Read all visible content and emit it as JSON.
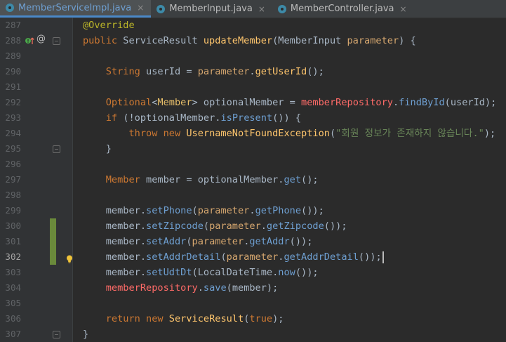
{
  "tabs": [
    {
      "label": "MemberServiceImpl.java",
      "active": true
    },
    {
      "label": "MemberInput.java",
      "active": false
    },
    {
      "label": "MemberController.java",
      "active": false
    }
  ],
  "tab_close_glyph": "×",
  "gutter_glyphs": {
    "at": "@"
  },
  "lines": [
    {
      "n": "287",
      "code": [
        [
          "ann",
          "@Override"
        ]
      ]
    },
    {
      "n": "288",
      "code": [
        [
          "kw",
          "public "
        ],
        [
          "var",
          "ServiceResult "
        ],
        [
          "fn",
          "updateMember"
        ],
        [
          "var",
          "("
        ],
        [
          "var",
          "MemberInput "
        ],
        [
          "param",
          "parameter"
        ],
        [
          "var",
          ") {"
        ]
      ]
    },
    {
      "n": "289",
      "code": []
    },
    {
      "n": "290",
      "code": [
        [
          "var",
          "    "
        ],
        [
          "clsref",
          "String "
        ],
        [
          "var",
          "userId = "
        ],
        [
          "param",
          "parameter"
        ],
        [
          "var",
          "."
        ],
        [
          "fn",
          "getUserId"
        ],
        [
          "var",
          "();"
        ]
      ]
    },
    {
      "n": "291",
      "code": []
    },
    {
      "n": "292",
      "code": [
        [
          "var",
          "    "
        ],
        [
          "clsref",
          "Optional"
        ],
        [
          "var",
          "<"
        ],
        [
          "generic",
          "Member"
        ],
        [
          "var",
          "> optionalMember = "
        ],
        [
          "field-red",
          "memberRepository"
        ],
        [
          "var",
          "."
        ],
        [
          "mtd",
          "findById"
        ],
        [
          "var",
          "(userId);"
        ]
      ]
    },
    {
      "n": "293",
      "code": [
        [
          "var",
          "    "
        ],
        [
          "kw",
          "if "
        ],
        [
          "var",
          "(!optionalMember."
        ],
        [
          "mtd",
          "isPresent"
        ],
        [
          "var",
          "()) {"
        ]
      ]
    },
    {
      "n": "294",
      "code": [
        [
          "var",
          "        "
        ],
        [
          "kw",
          "throw new "
        ],
        [
          "fn",
          "UsernameNotFoundException"
        ],
        [
          "var",
          "("
        ],
        [
          "str",
          "\"회원 정보가 존재하지 않습니다.\""
        ],
        [
          "var",
          ");"
        ]
      ]
    },
    {
      "n": "295",
      "code": [
        [
          "var",
          "    }"
        ]
      ]
    },
    {
      "n": "296",
      "code": []
    },
    {
      "n": "297",
      "code": [
        [
          "var",
          "    "
        ],
        [
          "clsref",
          "Member "
        ],
        [
          "var",
          "member = optionalMember."
        ],
        [
          "mtd",
          "get"
        ],
        [
          "var",
          "();"
        ]
      ]
    },
    {
      "n": "298",
      "code": []
    },
    {
      "n": "299",
      "code": [
        [
          "var",
          "    member."
        ],
        [
          "mtd",
          "setPhone"
        ],
        [
          "var",
          "("
        ],
        [
          "param",
          "parameter"
        ],
        [
          "var",
          "."
        ],
        [
          "mtd",
          "getPhone"
        ],
        [
          "var",
          "());"
        ]
      ]
    },
    {
      "n": "300",
      "code": [
        [
          "var",
          "    member."
        ],
        [
          "mtd",
          "setZipcode"
        ],
        [
          "var",
          "("
        ],
        [
          "param",
          "parameter"
        ],
        [
          "var",
          "."
        ],
        [
          "mtd",
          "getZipcode"
        ],
        [
          "var",
          "());"
        ]
      ]
    },
    {
      "n": "301",
      "code": [
        [
          "var",
          "    member."
        ],
        [
          "mtd",
          "setAddr"
        ],
        [
          "var",
          "("
        ],
        [
          "param",
          "parameter"
        ],
        [
          "var",
          "."
        ],
        [
          "mtd",
          "getAddr"
        ],
        [
          "var",
          "());"
        ]
      ]
    },
    {
      "n": "302",
      "code": [
        [
          "var",
          "    member."
        ],
        [
          "mtd",
          "setAddrDetail"
        ],
        [
          "var",
          "("
        ],
        [
          "param",
          "parameter"
        ],
        [
          "var",
          "."
        ],
        [
          "mtd",
          "getAddrDetail"
        ],
        [
          "var",
          "());"
        ]
      ]
    },
    {
      "n": "303",
      "code": [
        [
          "var",
          "    member."
        ],
        [
          "mtd",
          "setUdtDt"
        ],
        [
          "var",
          "("
        ],
        [
          "var",
          "LocalDateTime."
        ],
        [
          "mtd",
          "now"
        ],
        [
          "var",
          "());"
        ]
      ]
    },
    {
      "n": "304",
      "code": [
        [
          "var",
          "    "
        ],
        [
          "field-red",
          "memberRepository"
        ],
        [
          "var",
          "."
        ],
        [
          "mtd",
          "save"
        ],
        [
          "var",
          "(member);"
        ]
      ]
    },
    {
      "n": "305",
      "code": []
    },
    {
      "n": "306",
      "code": [
        [
          "var",
          "    "
        ],
        [
          "kw",
          "return new "
        ],
        [
          "fn",
          "ServiceResult"
        ],
        [
          "var",
          "("
        ],
        [
          "kw",
          "true"
        ],
        [
          "var",
          ");"
        ]
      ]
    },
    {
      "n": "307",
      "code": [
        [
          "var",
          "}"
        ]
      ]
    }
  ],
  "current_line": "302",
  "colors": {
    "background": "#2b2b2b",
    "gutter": "#313335",
    "active_tab_accent": "#4a88c7",
    "changed_lines_marker": "#6a8a3b"
  }
}
